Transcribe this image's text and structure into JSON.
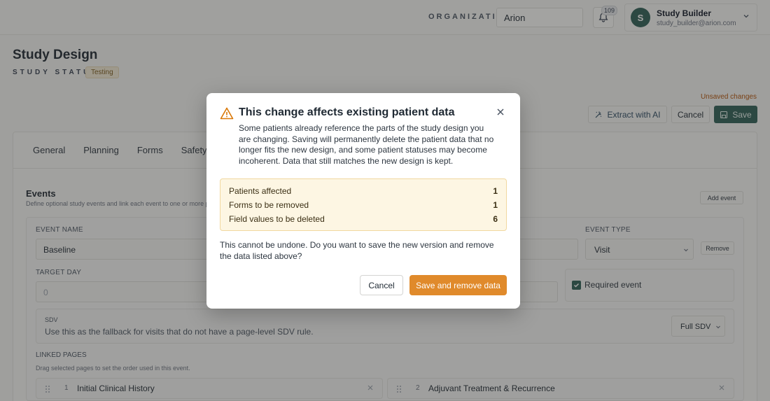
{
  "topbar": {
    "org_label": "ORGANIZATION",
    "org_value": "Arion",
    "notification_count": "109",
    "user": {
      "initial": "S",
      "name": "Study Builder",
      "email": "study_builder@arion.com"
    }
  },
  "page": {
    "title": "Study Design",
    "status_label": "STUDY STATUS",
    "status_value": "Testing",
    "unsaved": "Unsaved changes"
  },
  "toolbar": {
    "extract": "Extract with AI",
    "cancel": "Cancel",
    "save": "Save"
  },
  "tabs": [
    "General",
    "Planning",
    "Forms",
    "Safety Rules"
  ],
  "events": {
    "title": "Events",
    "description": "Define optional study events and link each event to one or more pages.",
    "add": "Add event",
    "event_name_label": "EVENT NAME",
    "event_name_value": "Baseline",
    "event_type_label": "EVENT TYPE",
    "event_type_value": "Visit",
    "remove": "Remove",
    "target_day_label": "TARGET DAY",
    "target_day_value": "0",
    "required_label": "Required event",
    "sdv_label": "SDV",
    "sdv_desc": "Use this as the fallback for visits that do not have a page-level SDV rule.",
    "sdv_value": "Full SDV",
    "linked_label": "LINKED PAGES",
    "linked_desc": "Drag selected pages to set the order used in this event.",
    "pages": [
      {
        "num": "1",
        "name": "Initial Clinical History"
      },
      {
        "num": "2",
        "name": "Adjuvant Treatment & Recurrence"
      }
    ]
  },
  "modal": {
    "title": "This change affects existing patient data",
    "body": "Some patients already reference the parts of the study design you are changing. Saving will permanently delete the patient data that no longer fits the new design, and some patient statuses may become incoherent. Data that still matches the new design is kept.",
    "impact": [
      {
        "label": "Patients affected",
        "value": "1"
      },
      {
        "label": "Forms to be removed",
        "value": "1"
      },
      {
        "label": "Field values to be deleted",
        "value": "6"
      }
    ],
    "question": "This cannot be undone. Do you want to save the new version and remove the data listed above?",
    "cancel": "Cancel",
    "confirm": "Save and remove data"
  },
  "colors": {
    "brand": "#2f5f56",
    "warning": "#e08a2b",
    "warning_bg": "#fdf6e3"
  }
}
